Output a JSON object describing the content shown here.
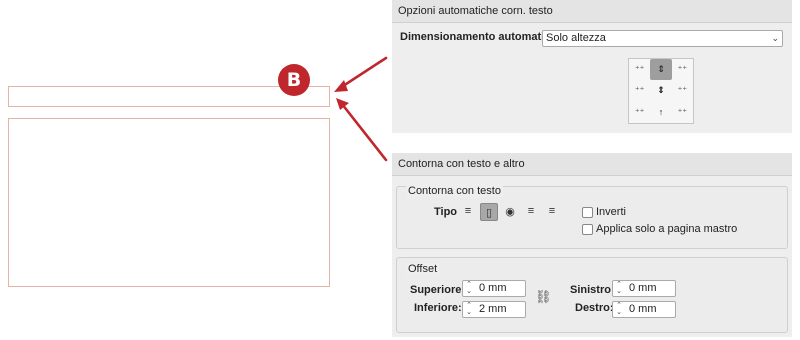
{
  "badge": {
    "letter": "B"
  },
  "autosize_panel": {
    "title": "Opzioni automatiche corn. testo",
    "label": "Dimensionamento automatico",
    "select_value": "Solo altezza",
    "grid_glyphs": [
      "⁺⁺",
      "⇕",
      "⁺⁺",
      "⁺⁺",
      "⇕",
      "⁺⁺",
      "⁺⁺",
      "↑",
      "⁺⁺"
    ]
  },
  "wrap_panel": {
    "title": "Contorna con testo e altro",
    "group_title": "Contorna con testo",
    "type_label": "Tipo",
    "wrap_buttons": [
      "≡",
      "▯",
      "◉",
      "≡",
      "≡"
    ],
    "invert_label": "Inverti",
    "master_label": "Applica solo a pagina mastro"
  },
  "offset": {
    "title": "Offset",
    "top_label": "Superiore:",
    "top_value": "0 mm",
    "bottom_label": "Inferiore:",
    "bottom_value": "2 mm",
    "left_label": "Sinistro:",
    "left_value": "0 mm",
    "right_label": "Destro:",
    "right_value": "0 mm"
  },
  "colors": {
    "accent": "#c0272d",
    "frame_border": "#e7b3a6"
  }
}
